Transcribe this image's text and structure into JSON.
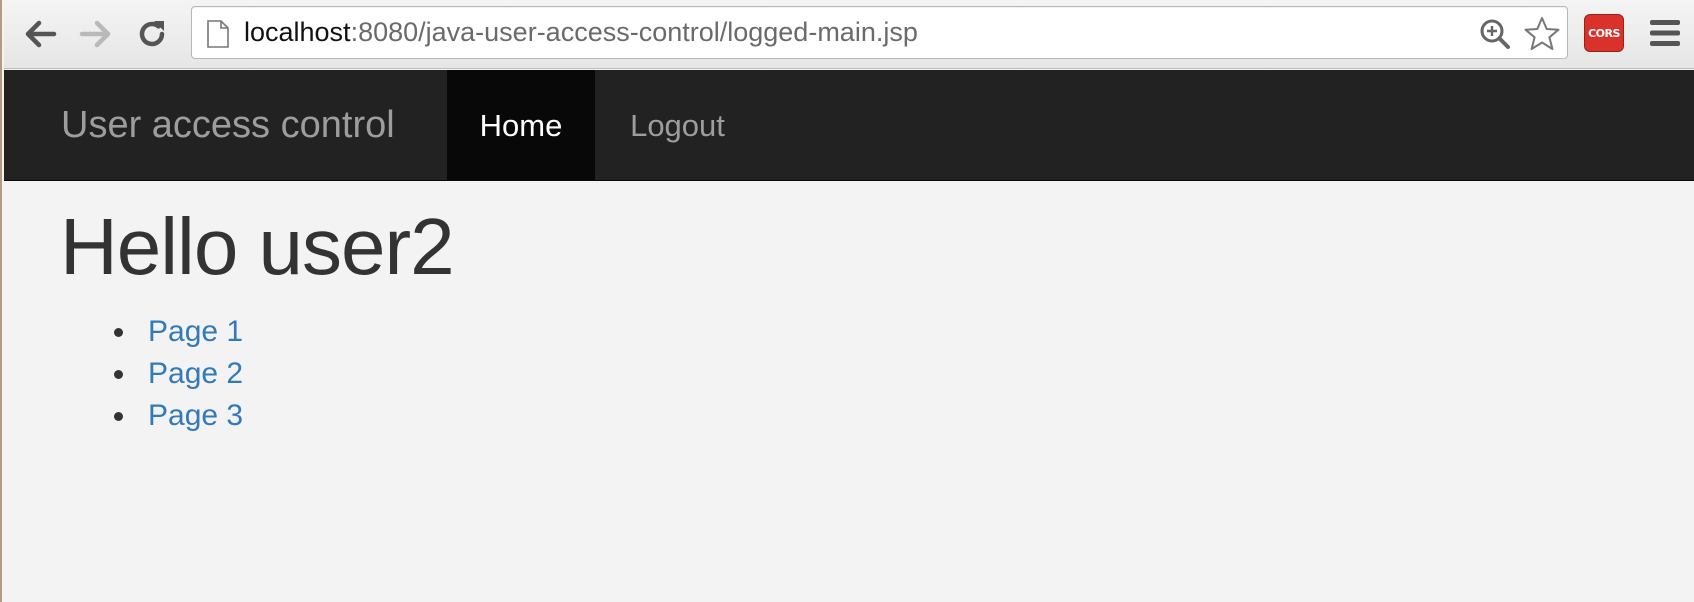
{
  "browser": {
    "url_host": "localhost",
    "url_path": ":8080/java-user-access-control/logged-main.jsp",
    "extension_label": "CORS",
    "icons": {
      "back": "back-arrow-icon",
      "forward": "forward-arrow-icon",
      "reload": "reload-icon",
      "page": "page-icon",
      "zoom": "zoom-icon",
      "bookmark": "star-icon",
      "menu": "menu-icon"
    }
  },
  "navbar": {
    "brand": "User access control",
    "items": [
      {
        "label": "Home",
        "active": true
      },
      {
        "label": "Logout",
        "active": false
      }
    ]
  },
  "main": {
    "greeting": "Hello user2",
    "links": [
      "Page 1",
      "Page 2",
      "Page 3"
    ]
  },
  "colors": {
    "navbar_bg": "#222222",
    "nav_active_bg": "#080808",
    "link": "#337ab7",
    "page_bg": "#f3f3f3",
    "extension_bg": "#d9322b"
  }
}
